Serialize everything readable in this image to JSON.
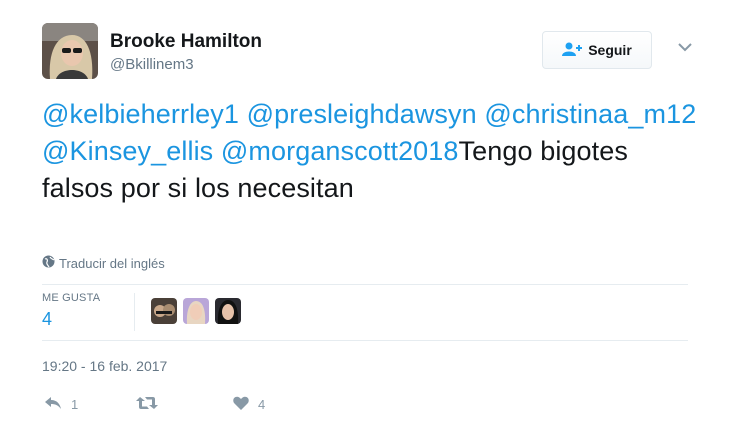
{
  "author": {
    "name": "Brooke Hamilton",
    "handle": "@Bkillinem3",
    "avatar_icon": "avatar-photo"
  },
  "follow_button": {
    "label": "Seguir",
    "icon": "add-user-icon"
  },
  "menu_icon": "chevron-down-icon",
  "tweet": {
    "mentions": [
      "@kelbieherrley1",
      "@presleighdawsyn",
      "@christinaa_m12",
      "@Kinsey_ellis",
      "@morganscott2018"
    ],
    "text": "Tengo bigotes falsos por si los necesitan"
  },
  "translate": {
    "label": "Traducir del inglés",
    "icon": "globe-icon"
  },
  "likes": {
    "label": "ME GUSTA",
    "count": "4",
    "avatars": [
      "liker-avatar-1",
      "liker-avatar-2",
      "liker-avatar-3"
    ]
  },
  "timestamp": "19:20 - 16 feb. 2017",
  "actions": {
    "reply_count": "1",
    "retweet_count": "",
    "like_count": "4"
  },
  "colors": {
    "link": "#1b95e0",
    "muted": "#657786",
    "divider": "#e6ecf0"
  }
}
